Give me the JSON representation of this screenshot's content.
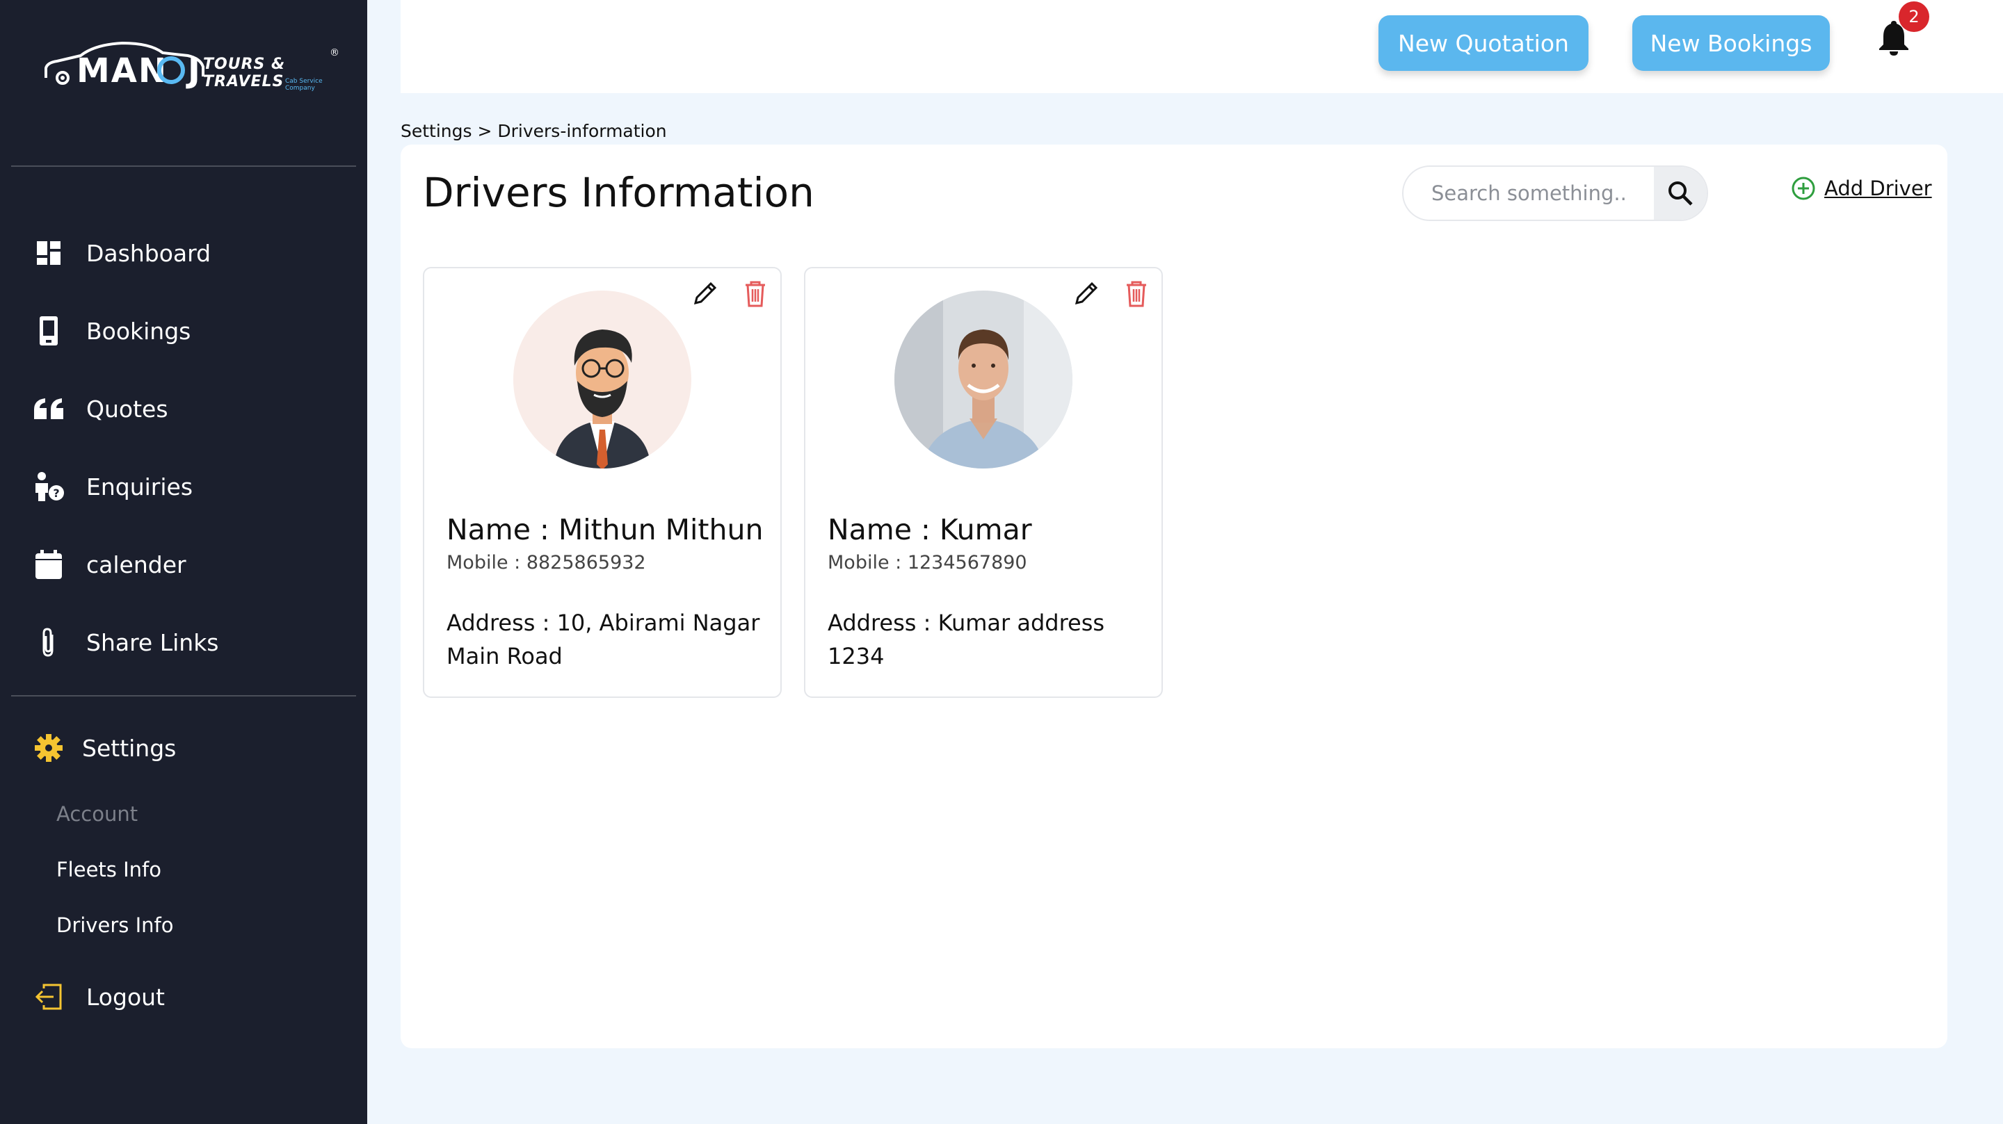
{
  "brand": {
    "name": "MAN",
    "name_end": "J",
    "tagline": "TOURS & TRAVELS",
    "subtitle": "Cab Service Company",
    "reg": "®"
  },
  "sidebar": {
    "items": [
      {
        "label": "Dashboard",
        "icon": "dashboard-icon"
      },
      {
        "label": "Bookings",
        "icon": "phone-icon"
      },
      {
        "label": "Quotes",
        "icon": "quote-icon"
      },
      {
        "label": "Enquiries",
        "icon": "person-question-icon"
      },
      {
        "label": "calender",
        "icon": "calendar-icon"
      },
      {
        "label": "Share Links",
        "icon": "paperclip-icon"
      }
    ],
    "settings": {
      "label": "Settings",
      "icon": "gear-icon",
      "accent": "#f5c431"
    },
    "sub_items": [
      {
        "label": "Account"
      },
      {
        "label": "Fleets Info"
      },
      {
        "label": "Drivers Info"
      }
    ],
    "logout": {
      "label": "Logout",
      "icon": "logout-icon",
      "accent": "#f5c431"
    }
  },
  "header": {
    "new_quotation": "New Quotation",
    "new_bookings": "New Bookings",
    "notification_count": "2",
    "accent": "#5bb7ee"
  },
  "breadcrumb": "Settings > Drivers-information",
  "main": {
    "title": "Drivers Information",
    "search_placeholder": "Search something..",
    "add_driver": "Add Driver",
    "drivers": [
      {
        "name": "Name : Mithun Mithun",
        "mobile": "Mobile : 8825865932",
        "address": "Address : 10, Abirami Nagar Main Road"
      },
      {
        "name": "Name : Kumar",
        "mobile": "Mobile : 1234567890",
        "address": "Address : Kumar address 1234"
      }
    ]
  }
}
